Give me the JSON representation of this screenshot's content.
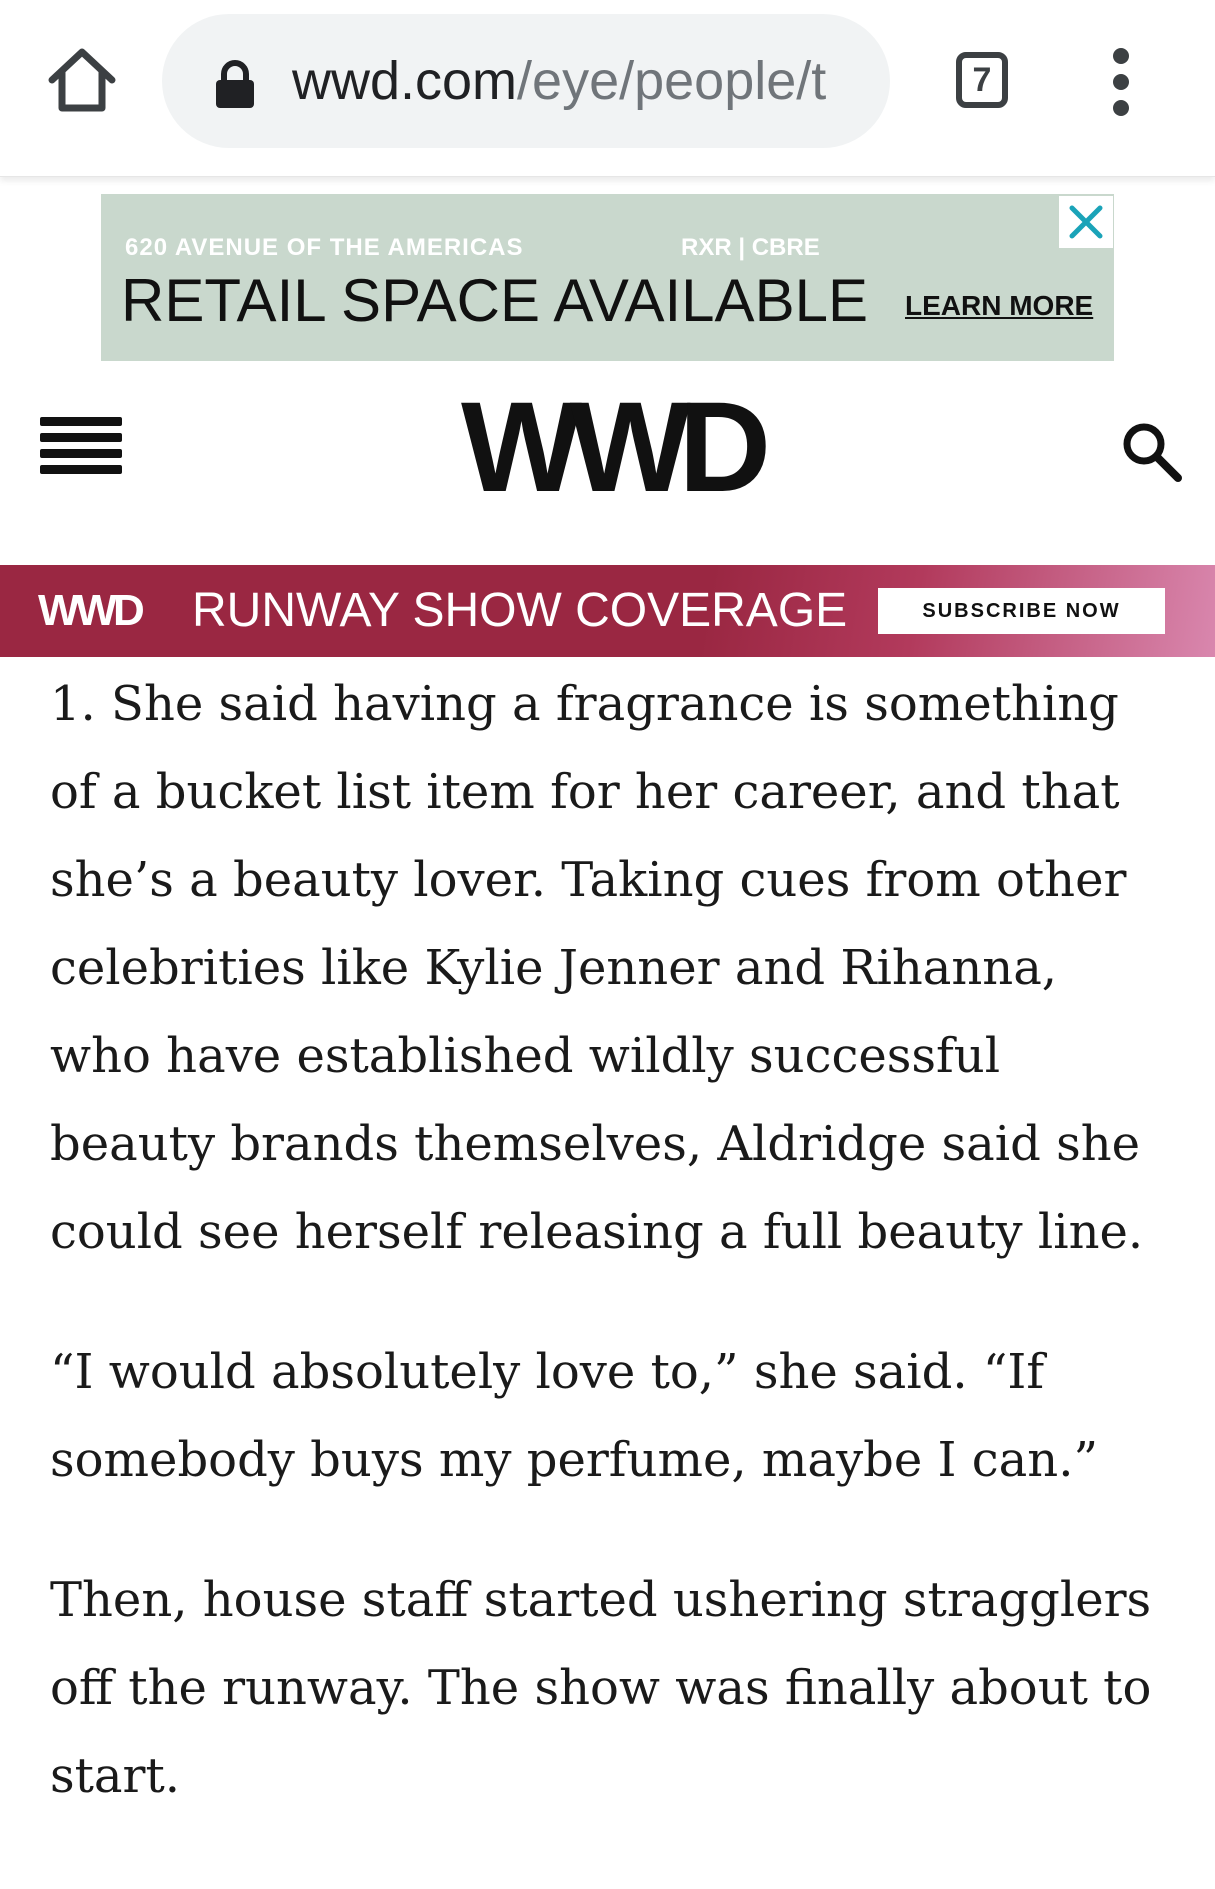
{
  "browser": {
    "url_host": "wwd.com",
    "url_path": "/eye/people/t",
    "tab_count": "7"
  },
  "ad": {
    "address": "620 AVENUE OF THE AMERICAS",
    "brands": "RXR | CBRE",
    "headline": "RETAIL SPACE AVAILABLE",
    "cta": "LEARN MORE",
    "accent_color": "#c9d8cd"
  },
  "site": {
    "logo": "WWD"
  },
  "promo_strip": {
    "logo": "WWD",
    "title": "RUNWAY SHOW COVERAGE",
    "cta": "SUBSCRIBE NOW",
    "color": "#9a2742"
  },
  "article": {
    "paragraphs": [
      "1. She said having a fragrance is something of a bucket list item for her career, and that she’s a beauty lover. Taking cues from other celebrities like Kylie Jenner and Rihanna, who have established wildly successful beauty brands themselves, Aldridge said she could see herself releasing a full beauty line.",
      "“I would absolutely love to,” she said. “If somebody buys my perfume, maybe I can.”",
      "Then, house staff started ushering stragglers off the runway. The show was finally about to start."
    ]
  }
}
